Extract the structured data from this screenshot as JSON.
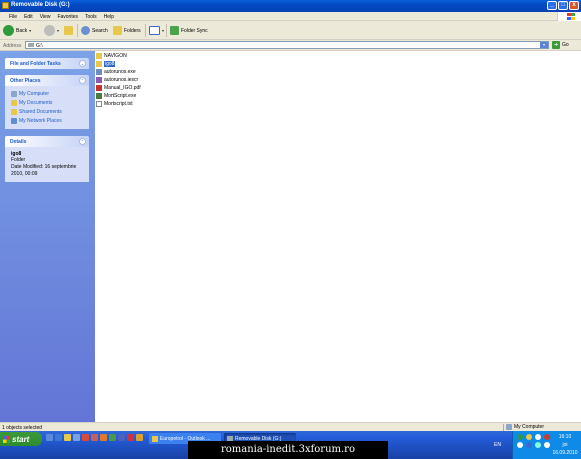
{
  "window": {
    "title": "Removable Disk (G:)",
    "buttons": {
      "minimize": "_",
      "maximize": "□",
      "close": "x"
    }
  },
  "menu": [
    "File",
    "Edit",
    "View",
    "Favorites",
    "Tools",
    "Help"
  ],
  "toolbar": {
    "back_label": "Back",
    "search_label": "Search",
    "folders_label": "Folders",
    "folder_sync_label": "Folder Sync"
  },
  "address": {
    "label": "Address",
    "value": "G:\\",
    "go_label": "Go"
  },
  "left_pane": {
    "file_tasks_title": "File and Folder Tasks",
    "other_places_title": "Other Places",
    "other_places": [
      "My Computer",
      "My Documents",
      "Shared Documents",
      "My Network Places"
    ],
    "details_title": "Details",
    "details": {
      "name": "igo8",
      "type": "Folder",
      "date_modified_line1": "Date Modified: 16 septembrie",
      "date_modified_line2": "2010, 00:09"
    }
  },
  "files": [
    {
      "name": "NAVIGON",
      "icon": "folder-icon",
      "selected": false
    },
    {
      "name": "igo8",
      "icon": "folder-icon",
      "selected": true
    },
    {
      "name": "autorunos.exe",
      "icon": "exe-icon",
      "selected": false
    },
    {
      "name": "autorunos.iescr",
      "icon": "script-icon",
      "selected": false
    },
    {
      "name": "Manual_IGO.pdf",
      "icon": "pdf-icon",
      "selected": false
    },
    {
      "name": "MortScript.exe",
      "icon": "exe-icon",
      "selected": false
    },
    {
      "name": "Mortscript.txt",
      "icon": "text-file-icon",
      "selected": false
    }
  ],
  "status": {
    "left": "1 objects selected",
    "right": "My Computer"
  },
  "taskbar": {
    "start_label": "start",
    "tasks": [
      "Europetrol - Outlook ...",
      "Removable Disk (G:)"
    ],
    "language": "EN",
    "clock_time": "16:10",
    "clock_day": "joi",
    "clock_date": "16.09.2010"
  },
  "watermark": "romania-inedit.3xforum.ro",
  "colors": {
    "title_blue": "#0349c2",
    "pane_blue": "#7ba2e7",
    "selection": "#316ac5",
    "start_green": "#2e8b2e",
    "tray_blue": "#0f8ae6"
  }
}
